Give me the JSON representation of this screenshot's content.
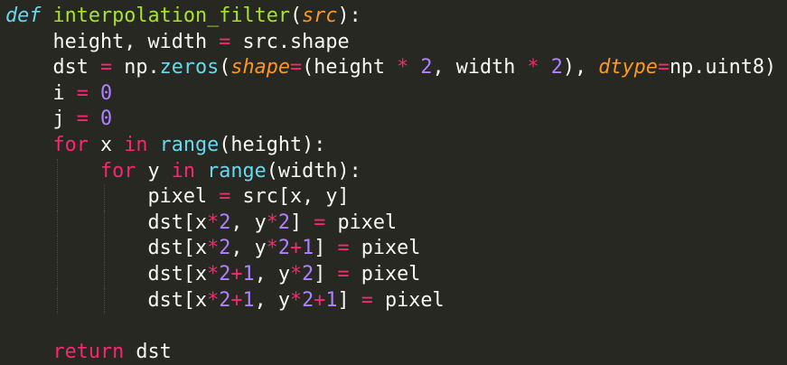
{
  "editor": {
    "theme_colors": {
      "background": "#272822",
      "keyword": "#f92672",
      "def_keyword": "#66d9ef",
      "function": "#a6e22e",
      "parameter": "#fd971f",
      "number": "#ae81ff",
      "text": "#f8f8f2"
    },
    "lines": [
      {
        "indent": 0,
        "tokens": [
          {
            "t": "def",
            "c": "kw-def"
          },
          {
            "t": " ",
            "c": "plain"
          },
          {
            "t": "interpolation_filter",
            "c": "fn"
          },
          {
            "t": "(",
            "c": "plain"
          },
          {
            "t": "src",
            "c": "param"
          },
          {
            "t": "):",
            "c": "plain"
          }
        ]
      },
      {
        "indent": 1,
        "tokens": [
          {
            "t": "height, width ",
            "c": "plain"
          },
          {
            "t": "=",
            "c": "op"
          },
          {
            "t": " src.shape",
            "c": "plain"
          }
        ]
      },
      {
        "indent": 1,
        "tokens": [
          {
            "t": "dst ",
            "c": "plain"
          },
          {
            "t": "=",
            "c": "op"
          },
          {
            "t": " np.",
            "c": "plain"
          },
          {
            "t": "zeros",
            "c": "builtin"
          },
          {
            "t": "(",
            "c": "plain"
          },
          {
            "t": "shape",
            "c": "param"
          },
          {
            "t": "=",
            "c": "op"
          },
          {
            "t": "(height ",
            "c": "plain"
          },
          {
            "t": "*",
            "c": "op"
          },
          {
            "t": " ",
            "c": "plain"
          },
          {
            "t": "2",
            "c": "num"
          },
          {
            "t": ", width ",
            "c": "plain"
          },
          {
            "t": "*",
            "c": "op"
          },
          {
            "t": " ",
            "c": "plain"
          },
          {
            "t": "2",
            "c": "num"
          },
          {
            "t": "), ",
            "c": "plain"
          },
          {
            "t": "dtype",
            "c": "param"
          },
          {
            "t": "=",
            "c": "op"
          },
          {
            "t": "np.uint8)",
            "c": "plain"
          }
        ]
      },
      {
        "indent": 1,
        "tokens": [
          {
            "t": "i ",
            "c": "plain"
          },
          {
            "t": "=",
            "c": "op"
          },
          {
            "t": " ",
            "c": "plain"
          },
          {
            "t": "0",
            "c": "num"
          }
        ]
      },
      {
        "indent": 1,
        "tokens": [
          {
            "t": "j ",
            "c": "plain"
          },
          {
            "t": "=",
            "c": "op"
          },
          {
            "t": " ",
            "c": "plain"
          },
          {
            "t": "0",
            "c": "num"
          }
        ]
      },
      {
        "indent": 1,
        "tokens": [
          {
            "t": "for",
            "c": "kw"
          },
          {
            "t": " x ",
            "c": "plain"
          },
          {
            "t": "in",
            "c": "kw"
          },
          {
            "t": " ",
            "c": "plain"
          },
          {
            "t": "range",
            "c": "builtin"
          },
          {
            "t": "(height):",
            "c": "plain"
          }
        ]
      },
      {
        "indent": 2,
        "tokens": [
          {
            "t": "for",
            "c": "kw"
          },
          {
            "t": " y ",
            "c": "plain"
          },
          {
            "t": "in",
            "c": "kw"
          },
          {
            "t": " ",
            "c": "plain"
          },
          {
            "t": "range",
            "c": "builtin"
          },
          {
            "t": "(width):",
            "c": "plain"
          }
        ]
      },
      {
        "indent": 3,
        "tokens": [
          {
            "t": "pixel ",
            "c": "plain"
          },
          {
            "t": "=",
            "c": "op"
          },
          {
            "t": " src[x, y]",
            "c": "plain"
          }
        ]
      },
      {
        "indent": 3,
        "tokens": [
          {
            "t": "dst[x",
            "c": "plain"
          },
          {
            "t": "*",
            "c": "op"
          },
          {
            "t": "2",
            "c": "num"
          },
          {
            "t": ", y",
            "c": "plain"
          },
          {
            "t": "*",
            "c": "op"
          },
          {
            "t": "2",
            "c": "num"
          },
          {
            "t": "] ",
            "c": "plain"
          },
          {
            "t": "=",
            "c": "op"
          },
          {
            "t": " pixel",
            "c": "plain"
          }
        ]
      },
      {
        "indent": 3,
        "tokens": [
          {
            "t": "dst[x",
            "c": "plain"
          },
          {
            "t": "*",
            "c": "op"
          },
          {
            "t": "2",
            "c": "num"
          },
          {
            "t": ", y",
            "c": "plain"
          },
          {
            "t": "*",
            "c": "op"
          },
          {
            "t": "2",
            "c": "num"
          },
          {
            "t": "+",
            "c": "op"
          },
          {
            "t": "1",
            "c": "num"
          },
          {
            "t": "] ",
            "c": "plain"
          },
          {
            "t": "=",
            "c": "op"
          },
          {
            "t": " pixel",
            "c": "plain"
          }
        ]
      },
      {
        "indent": 3,
        "tokens": [
          {
            "t": "dst[x",
            "c": "plain"
          },
          {
            "t": "*",
            "c": "op"
          },
          {
            "t": "2",
            "c": "num"
          },
          {
            "t": "+",
            "c": "op"
          },
          {
            "t": "1",
            "c": "num"
          },
          {
            "t": ", y",
            "c": "plain"
          },
          {
            "t": "*",
            "c": "op"
          },
          {
            "t": "2",
            "c": "num"
          },
          {
            "t": "] ",
            "c": "plain"
          },
          {
            "t": "=",
            "c": "op"
          },
          {
            "t": " pixel",
            "c": "plain"
          }
        ]
      },
      {
        "indent": 3,
        "tokens": [
          {
            "t": "dst[x",
            "c": "plain"
          },
          {
            "t": "*",
            "c": "op"
          },
          {
            "t": "2",
            "c": "num"
          },
          {
            "t": "+",
            "c": "op"
          },
          {
            "t": "1",
            "c": "num"
          },
          {
            "t": ", y",
            "c": "plain"
          },
          {
            "t": "*",
            "c": "op"
          },
          {
            "t": "2",
            "c": "num"
          },
          {
            "t": "+",
            "c": "op"
          },
          {
            "t": "1",
            "c": "num"
          },
          {
            "t": "] ",
            "c": "plain"
          },
          {
            "t": "=",
            "c": "op"
          },
          {
            "t": " pixel",
            "c": "plain"
          }
        ]
      },
      {
        "indent": 0,
        "tokens": []
      },
      {
        "indent": 1,
        "tokens": [
          {
            "t": "return",
            "c": "kw"
          },
          {
            "t": " dst",
            "c": "plain"
          }
        ]
      }
    ]
  }
}
